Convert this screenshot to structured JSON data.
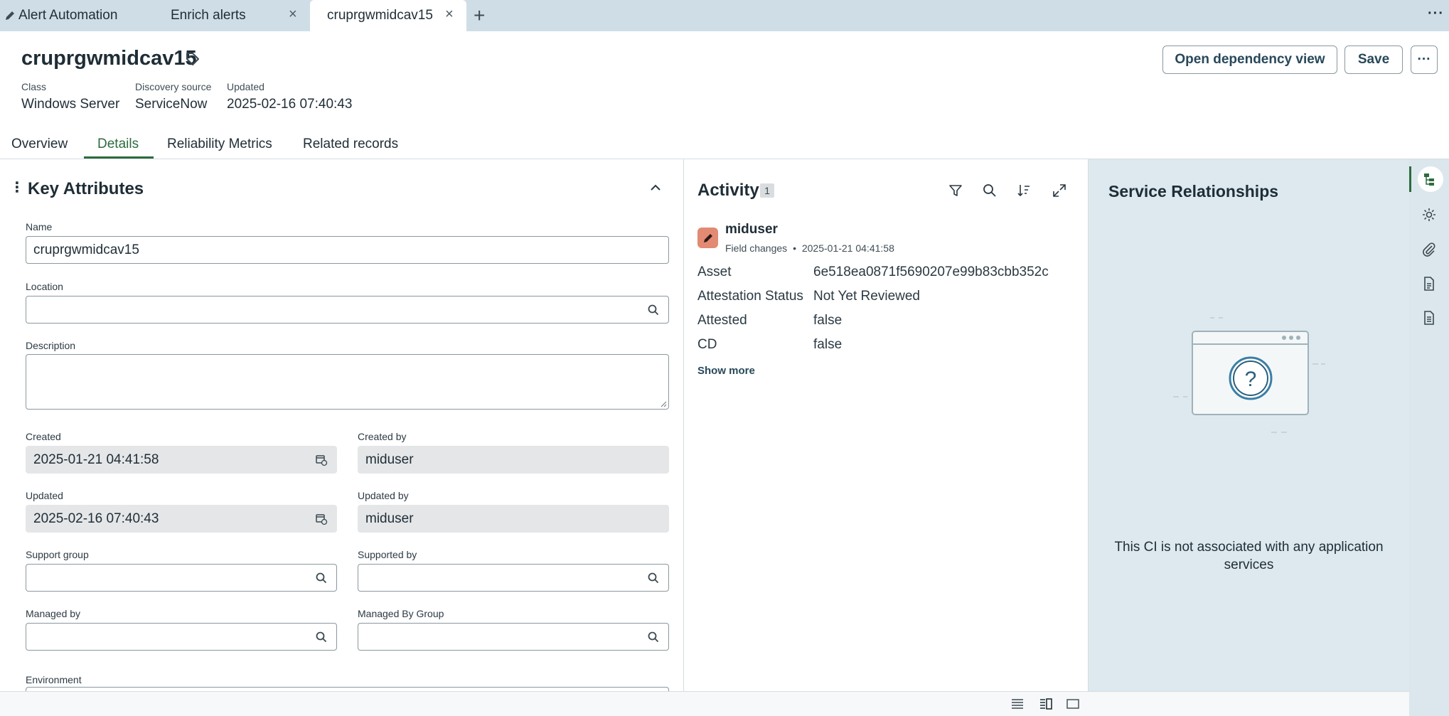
{
  "tabs": [
    {
      "label": "Alert Automation",
      "icon": "pencil-icon"
    },
    {
      "label": "Enrich alerts",
      "close": "×"
    },
    {
      "label": "cruprgwmidcav15",
      "close": "×",
      "active": true
    }
  ],
  "tab_add": "+",
  "tab_menu": "···",
  "record": {
    "title": "cruprgwmidcav15",
    "meta": [
      {
        "label": "Class",
        "value": "Windows Server"
      },
      {
        "label": "Discovery source",
        "value": "ServiceNow"
      },
      {
        "label": "Updated",
        "value": "2025-02-16 07:40:43"
      }
    ]
  },
  "header_buttons": {
    "dependency": "Open dependency view",
    "save": "Save",
    "more": "···"
  },
  "record_tabs": [
    "Overview",
    "Details",
    "Reliability Metrics",
    "Related records"
  ],
  "key_attributes": {
    "title": "Key Attributes",
    "kebab": "⋮",
    "fields": {
      "name": {
        "label": "Name",
        "value": "cruprgwmidcav15"
      },
      "location": {
        "label": "Location",
        "value": ""
      },
      "description": {
        "label": "Description",
        "value": ""
      },
      "created": {
        "label": "Created",
        "value": "2025-01-21 04:41:58"
      },
      "created_by": {
        "label": "Created by",
        "value": "miduser"
      },
      "updated": {
        "label": "Updated",
        "value": "2025-02-16 07:40:43"
      },
      "updated_by": {
        "label": "Updated by",
        "value": "miduser"
      },
      "support_group": {
        "label": "Support group",
        "value": ""
      },
      "supported_by": {
        "label": "Supported by",
        "value": ""
      },
      "managed_by": {
        "label": "Managed by",
        "value": ""
      },
      "managed_by_group": {
        "label": "Managed By Group",
        "value": ""
      },
      "environment": {
        "label": "Environment",
        "value": ""
      }
    }
  },
  "activity": {
    "title": "Activity",
    "count": "1",
    "entry": {
      "user": "miduser",
      "kind": "Field changes",
      "separator": "•",
      "timestamp": "2025-01-21 04:41:58",
      "rows": [
        {
          "key": "Asset",
          "value": "6e518ea0871f5690207e99b83cbb352c"
        },
        {
          "key": "Attestation Status",
          "value": "Not Yet Reviewed"
        },
        {
          "key": "Attested",
          "value": "false"
        },
        {
          "key": "CD",
          "value": "false"
        }
      ]
    },
    "show_more": "Show more"
  },
  "service_relationships": {
    "title": "Service Relationships",
    "illustration_glyph": "?",
    "message": "This CI is not associated with any application services"
  },
  "colors": {
    "accent_green": "#2e6b3e",
    "tab_bar": "#cfdee6",
    "panel_blue": "#dde9ee",
    "avatar": "#e28a73"
  }
}
